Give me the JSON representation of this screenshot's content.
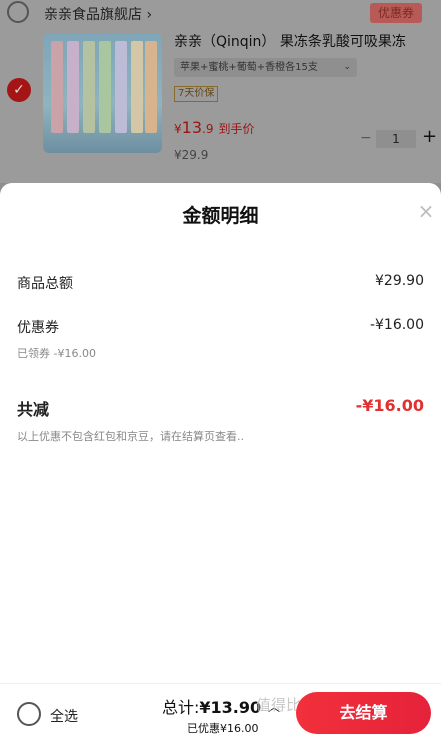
{
  "cart": {
    "shop_name": "亲亲食品旗舰店",
    "shop_chevron": "›",
    "shop_coupon_label": "优惠券",
    "product": {
      "title": "亲亲（Qinqin） 果冻条乳酸可吸果冻",
      "variant": "苹果+蜜桃+葡萄+香橙各15支",
      "variant_arrow": "⌄",
      "tag": "7天价保",
      "price_currency": "¥",
      "price_int": "13",
      "price_dec": ".9",
      "price_suffix": "到手价",
      "original_price": "¥29.9",
      "quantity": "1",
      "minus_label": "−",
      "plus_label": "+"
    }
  },
  "sheet": {
    "title": "金额明细",
    "close_label": "×",
    "rows": {
      "goods_total_label": "商品总额",
      "goods_total_value": "¥29.90",
      "coupon_label": "优惠券",
      "coupon_value": "-¥16.00",
      "coupon_note": "已领券 -¥16.00",
      "total_reduce_label": "共减",
      "total_reduce_value": "-¥16.00",
      "footnote": "以上优惠不包含红包和京豆，请在结算页查看.."
    }
  },
  "bottom_bar": {
    "select_all_label": "全选",
    "total_prefix": "总计:",
    "total_value": "¥13.90",
    "caret": "︿",
    "saved_text": "已优惠¥16.00",
    "checkout_label": "去结算",
    "watermark": "值得比"
  },
  "colors": {
    "accent_red": "#e5223a",
    "price_red": "#e0312f",
    "dim_overlay": "#9b9b9b"
  }
}
